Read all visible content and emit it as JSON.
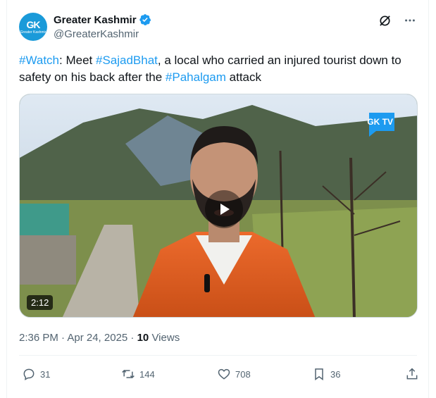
{
  "account": {
    "name": "Greater Kashmir",
    "handle": "@GreaterKashmir",
    "avatar_text": "GK",
    "avatar_subtext": "Greater Kashmir"
  },
  "tweet": {
    "parts": [
      {
        "text": "#Watch",
        "hashtag": true
      },
      {
        "text": ": Meet ",
        "hashtag": false
      },
      {
        "text": "#SajadBhat",
        "hashtag": true
      },
      {
        "text": ", a local who carried an injured tourist down to safety on his back after the ",
        "hashtag": false
      },
      {
        "text": "#Pahalgam",
        "hashtag": true
      },
      {
        "text": " attack",
        "hashtag": false
      }
    ]
  },
  "media": {
    "duration": "2:12",
    "watermark": "GK TV"
  },
  "meta": {
    "time": "2:36 PM · Apr 24, 2025 · ",
    "views_count": "10",
    "views_label": " Views"
  },
  "actions": {
    "replies": "31",
    "reposts": "144",
    "likes": "708",
    "bookmarks": "36"
  },
  "colors": {
    "accent": "#1d9bf0",
    "muted": "#536471",
    "text": "#0f1419"
  }
}
